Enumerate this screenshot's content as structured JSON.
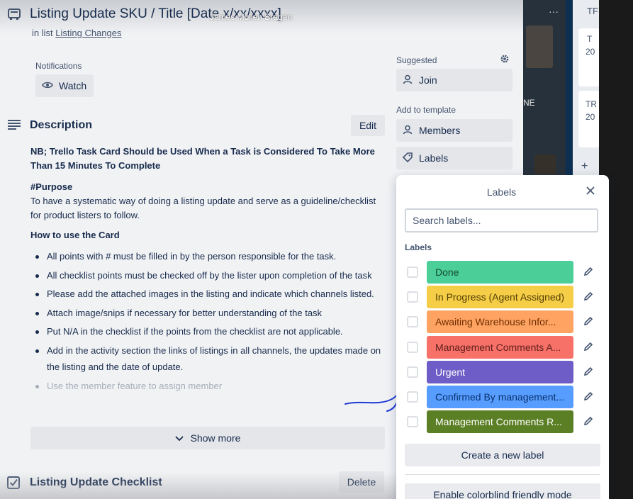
{
  "presenter": "James Mullen Bragan",
  "card": {
    "title": "Listing Update SKU / Title [Date x/xx/xxxx]",
    "in_list_prefix": "in list",
    "list_name": "Listing Changes"
  },
  "notifications": {
    "label": "Notifications",
    "watch_label": "Watch"
  },
  "description": {
    "title": "Description",
    "edit_label": "Edit",
    "note": "NB; Trello Task Card Should be Used When a Task is Considered To Take More Than 15 Minutes To Complete",
    "purpose_heading": "#Purpose",
    "purpose_text": "To have a systematic way of doing a listing update and serve as a guideline/checklist for product listers to follow.",
    "howto_heading": "How to use the Card",
    "items": [
      "All points with # must be filled in by the person responsible for the task.",
      "All checklist points must be checked off by the lister upon completion of the task",
      "Please add the attached images in the listing and indicate which channels listed.",
      "Attach image/snips if necessary for better understanding of the task",
      "Put N/A in the checklist if the points from the checklist are not applicable.",
      "Add in the activity section the links of listings in all channels, the updates made on the listing and the date of update.",
      "Use the member feature to assign member"
    ],
    "show_more": "Show more"
  },
  "checklist": {
    "title": "Listing Update Checklist",
    "delete_label": "Delete"
  },
  "sidebar": {
    "suggested_label": "Suggested",
    "join_label": "Join",
    "add_to_template_label": "Add to template",
    "members_label": "Members",
    "labels_label": "Labels"
  },
  "labels_popover": {
    "title": "Labels",
    "search_placeholder": "Search labels...",
    "section_label": "Labels",
    "labels": [
      {
        "name": "Done",
        "color": "#4bce97",
        "text_color": "#164b35"
      },
      {
        "name": "In Progress (Agent Assigned)",
        "color": "#f5cd47",
        "text_color": "#533f04"
      },
      {
        "name": "Awaiting Warehouse Infor...",
        "color": "#fea362",
        "text_color": "#702e00"
      },
      {
        "name": "Management Comments A...",
        "color": "#f87168",
        "text_color": "#5d1f1a"
      },
      {
        "name": "Urgent",
        "color": "#6e5dc6",
        "text_color": "#ffffff"
      },
      {
        "name": "Confirmed By management...",
        "color": "#579dff",
        "text_color": "#09326c"
      },
      {
        "name": "Management Comments R...",
        "color": "#5b7f24",
        "text_color": "#ffffff"
      }
    ],
    "create_label": "Create a new label",
    "colorblind_label": "Enable colorblind friendly mode"
  },
  "board": {
    "texts": [
      "TF",
      "T",
      "20",
      "NE",
      "TR",
      "20"
    ]
  }
}
